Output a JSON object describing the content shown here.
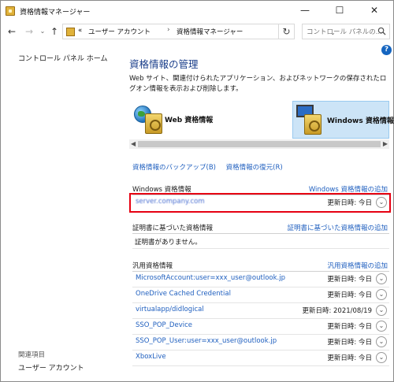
{
  "window": {
    "title": "資格情報マネージャー",
    "controls": {
      "minimize": "—",
      "maximize": "☐",
      "close": "✕"
    }
  },
  "address": {
    "prefix": "«",
    "crumbs": [
      "ユーザー アカウント",
      "資格情報マネージャー"
    ],
    "separator": "›",
    "search_placeholder": "コントロール パネルの..."
  },
  "nav": {
    "home": "コントロール パネル ホーム",
    "related_title": "関連項目",
    "related_items": [
      "ユーザー アカウント"
    ]
  },
  "main": {
    "title": "資格情報の管理",
    "description": "Web サイト、関連付けられたアプリケーション、およびネットワークの保存されたログオン情報を表示および削除します。",
    "tabs": [
      {
        "label": "Web 資格情報",
        "selected": false
      },
      {
        "label": "Windows 資格情報",
        "selected": true
      }
    ],
    "backup_link": "資格情報のバックアップ(B)",
    "restore_link": "資格情報の復元(R)"
  },
  "windows_creds": {
    "title": "Windows 資格情報",
    "add_link": "Windows 資格情報の追加",
    "items": [
      {
        "name": "server.company.com",
        "date": "更新日時: 今日",
        "highlighted": true
      }
    ]
  },
  "cert_creds": {
    "title": "証明書に基づいた資格情報",
    "add_link": "証明書に基づいた資格情報の追加",
    "empty": "証明書がありません。"
  },
  "generic_creds": {
    "title": "汎用資格情報",
    "add_link": "汎用資格情報の追加",
    "items": [
      {
        "name": "MicrosoftAccount:user=xxx_user@outlook.jp",
        "date": "更新日時: 今日"
      },
      {
        "name": "OneDrive Cached Credential",
        "date": "更新日時: 今日"
      },
      {
        "name": "virtualapp/didlogical",
        "date": "更新日時: 2021/08/19"
      },
      {
        "name": "SSO_POP_Device",
        "date": "更新日時: 今日"
      },
      {
        "name": "SSO_POP_User:user=xxx_user@outlook.jp",
        "date": "更新日時: 今日"
      },
      {
        "name": "XboxLive",
        "date": "更新日時: 今日"
      }
    ]
  },
  "colors": {
    "accent_link": "#1f5fbf",
    "title_blue": "#1b3f8b",
    "highlight_red": "#e60012",
    "tab_selected": "#cce4f7"
  }
}
